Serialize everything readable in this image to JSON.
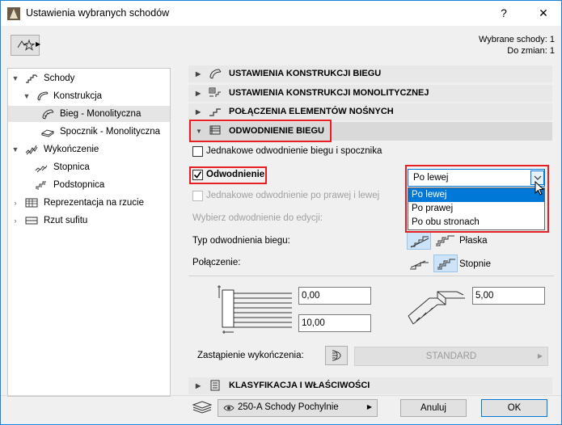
{
  "window": {
    "title": "Ustawienia wybranych schodów",
    "help": "?",
    "close": "✕"
  },
  "selection": {
    "selected": "Wybrane schody: 1",
    "to_change": "Do zmian: 1"
  },
  "tree": [
    {
      "label": "Schody"
    },
    {
      "label": "Konstrukcja"
    },
    {
      "label": "Bieg - Monolityczna"
    },
    {
      "label": "Spocznik - Monolityczna"
    },
    {
      "label": "Wykończenie"
    },
    {
      "label": "Stopnica"
    },
    {
      "label": "Podstopnica"
    },
    {
      "label": "Reprezentacja na rzucie"
    },
    {
      "label": "Rzut sufitu"
    }
  ],
  "sections": {
    "s1": "USTAWIENIA KONSTRUKCJI BIEGU",
    "s2": "USTAWIENIA KONSTRUKCJI MONOLITYCZNEJ",
    "s3": "POŁĄCZENIA ELEMENTÓW NOŚNYCH",
    "s4": "ODWODNIENIE BIEGU",
    "s5": "KLASYFIKACJA I WŁAŚCIWOŚCI"
  },
  "drainage": {
    "same_run_landing": "Jednakowe odwodnienie biegu i spocznika",
    "drainage_label": "Odwodnienie",
    "same_lr": "Jednakowe odwodnienie po prawej i lewej",
    "choose_edit": "Wybierz odwodnienie do edycji:",
    "type_label": "Typ odwodnienia biegu:",
    "type_value": "Płaska",
    "connection_label": "Połączenie:",
    "connection_value": "Stopnie",
    "dim1": "0,00",
    "dim2": "10,00",
    "dim3": "5,00",
    "replace_label": "Zastąpienie wykończenia:",
    "replace_value": "STANDARD",
    "dropdown": {
      "selected": "Po lewej",
      "options": [
        "Po lewej",
        "Po prawej",
        "Po obu stronach"
      ]
    }
  },
  "footer": {
    "layer": "250-A Schody Pochylnie",
    "cancel": "Anuluj",
    "ok": "OK"
  }
}
